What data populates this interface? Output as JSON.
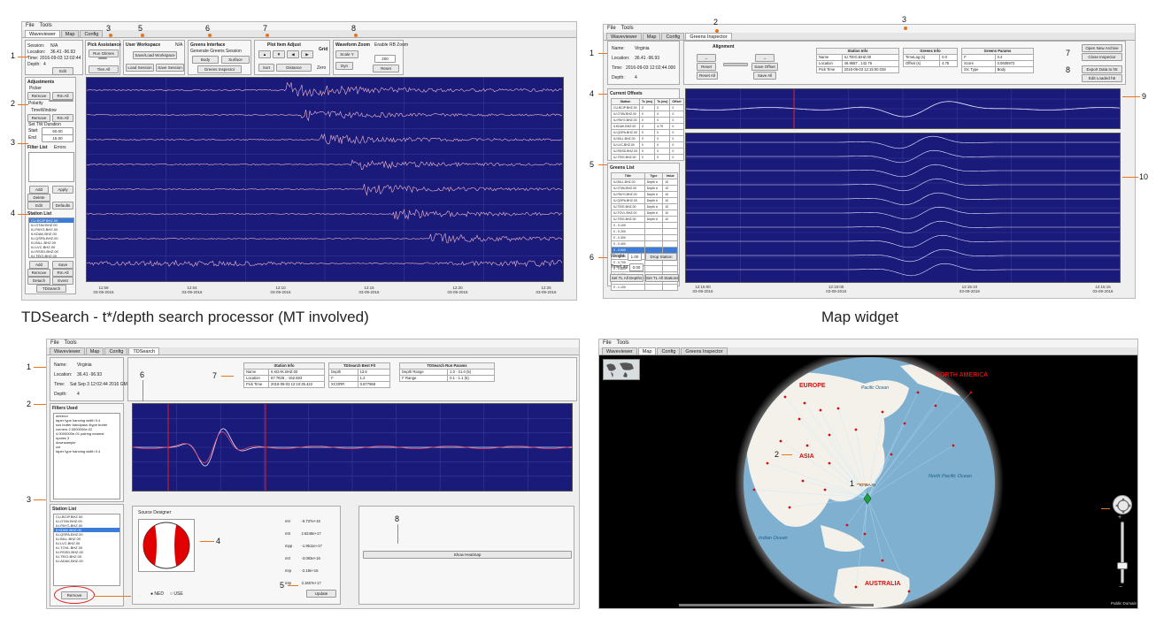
{
  "menu": {
    "file": "File",
    "tools": "Tools"
  },
  "panel1": {
    "tabs": [
      "Waveviewer",
      "Map",
      "Config"
    ],
    "session": {
      "session_lbl": "Session:",
      "session_val": "N/A",
      "location_lbl": "Location:",
      "location_val": "36.41 -96.93",
      "time_lbl": "Time:",
      "time_val": "2016-09-03 12:02:44",
      "depth_lbl": "Depth:",
      "depth_val": "4",
      "edit": "Edit"
    },
    "pick": {
      "title": "Pick Assistance",
      "run": "Run Gtimes",
      "tlen": "Tlen All"
    },
    "workspace": {
      "title": "User Workspace",
      "sub": "N/A",
      "save_load": "Save/Load Workspace",
      "load_session": "Load Session",
      "save_session": "Save Session"
    },
    "greens": {
      "title": "Greens Interface",
      "generate": "Generate Greens Session",
      "body": "Body",
      "surface": "Surface",
      "inspector": "Greens Inspector"
    },
    "plot_adjust": {
      "title": "Plot Item Adjust",
      "sort": "Sort",
      "distance": "Distance"
    },
    "grid": {
      "title": "Grid",
      "zero": "Zero"
    },
    "zoom": {
      "title": "Waveform Zoom",
      "scale": "Scale Y",
      "dyn": "Dyn",
      "enable": "Enable RB Zoom",
      "reset": "Reset",
      "width": "200"
    },
    "adjustments": {
      "title": "Adjustments",
      "picker": "Picker",
      "remove": "Remove",
      "rm_all": "Rm All",
      "polarity": "Polarity",
      "timewindow": "TimeWindow",
      "set_tw": "Set TW Duration",
      "start_lbl": "Start",
      "start_val": "60.00",
      "end_lbl": "End",
      "end_val": "15.00"
    },
    "filter": {
      "title": "Filter List",
      "errors": "Errors",
      "add": "Add",
      "apply": "Apply",
      "delete": "Delete",
      "edit": "Edit",
      "defaults": "Defaults"
    },
    "station": {
      "title": "Station List",
      "items": [
        "CU.BCIP.BHZ.00",
        "IU.OTAV.BHZ.00",
        "IU.PAYG.BHZ.00",
        "II.KDAK.BHZ.00",
        "IU.QSPA.BHZ.00",
        "IU.BILL.BHZ.00",
        "IU.LVC.BHZ.00",
        "IU.RSSD.BHZ.00",
        "IU.TEIG.BHZ.00"
      ],
      "add": "Add",
      "save": "Save",
      "remove": "Remove",
      "rm_all": "Rm All",
      "detach": "Detach",
      "event": "Event",
      "tdsearch": "TDSearch"
    },
    "times": [
      "11:59\n03-09-2016",
      "12:04\n03-09-2016",
      "12:10\n03-09-2016",
      "12:15\n03-09-2016",
      "12:20\n03-09-2016",
      "12:25\n03-09-2016"
    ]
  },
  "panel2": {
    "tabs": [
      "Waveviewer",
      "Map",
      "Config",
      "Greens Inspector"
    ],
    "info": {
      "name_lbl": "Name:",
      "name_val": "Virginia",
      "location_lbl": "Location:",
      "location_val": "36.41 -96.93",
      "time_lbl": "Time:",
      "time_val": "2016-09-03 12:02:44.000",
      "depth_lbl": "Depth:",
      "depth_val": "4"
    },
    "alignment": {
      "title": "Alignment",
      "reset": "Reset",
      "reset_all": "Reset All",
      "save_offset": "Save Offset",
      "save_all": "Save All"
    },
    "station_info": {
      "title": "Station Info",
      "rows": [
        [
          "Name",
          "IU.TEIG.BHZ.00"
        ],
        [
          "Location",
          "46.9587 , 142.76"
        ],
        [
          "Pick Time",
          "2016-09-03 12:15:00.038"
        ]
      ]
    },
    "greens_info": {
      "title": "Greens Info",
      "rows": [
        [
          "TimeLag (s)",
          "0.0"
        ],
        [
          "Offset (s)",
          "4.75"
        ]
      ]
    },
    "greens_params": {
      "title": "Greens Params",
      "rows": [
        [
          "t*",
          "0.4"
        ],
        [
          "Score",
          "0.0606972"
        ],
        [
          "Src Type",
          "Body"
        ]
      ]
    },
    "buttons": {
      "open": "Open New Archive",
      "close": "Close Inspector",
      "export": "Export Data to h5",
      "edit": "Edit Loaded h5"
    },
    "offsets": {
      "title": "Current Offsets",
      "cols": [
        "Station",
        "Tc (ms)",
        "Ts (ms)",
        "Offset"
      ],
      "rows": [
        [
          "CU.BCIP.BHZ.00",
          "0",
          "0",
          "0"
        ],
        [
          "IU.OTAV.BHZ.00",
          "0",
          "0",
          "0"
        ],
        [
          "IU.PAYG.BHZ.00",
          "0",
          "0",
          "0"
        ],
        [
          "II.KDAK.BHZ.00",
          "0",
          "4.75",
          "0"
        ],
        [
          "IU.QSPA.BHZ.00",
          "0",
          "0",
          "0"
        ],
        [
          "IU.BILL.BHZ.00",
          "0",
          "0",
          "0"
        ],
        [
          "IU.LVC.BHZ.00",
          "0",
          "0",
          "0"
        ],
        [
          "IU.RSSD.BHZ.00",
          "0",
          "0",
          "0"
        ],
        [
          "IU.TEIG.BHZ.00",
          "0",
          "0",
          "0"
        ]
      ]
    },
    "greens_list": {
      "title": "Greens List",
      "cols": [
        "Title",
        "Type",
        "Value"
      ],
      "rows": [
        [
          "IU.BILL.BHZ.00",
          "Depth #",
          "10"
        ],
        [
          "IU.OTAV.BHZ.00",
          "Depth #",
          "10"
        ],
        [
          "IU.PAYG.BHZ.00",
          "Depth #",
          "10"
        ],
        [
          "IU.QSPA.BHZ.00",
          "Depth #",
          "10"
        ],
        [
          "IU.TEIG.BHZ.00",
          "Depth #",
          "10"
        ],
        [
          "IU.TOVL.BHZ.00",
          "Depth #",
          "10"
        ],
        [
          "IU.TEIG.BHZ.00",
          "Depth #",
          "10"
        ],
        [
          "0 - 0.100",
          "",
          ""
        ],
        [
          "0 - 0.200",
          "",
          ""
        ],
        [
          "0 - 0.300",
          "",
          ""
        ],
        [
          "0 - 0.400",
          "",
          ""
        ],
        [
          "0 - 0.500",
          "",
          ""
        ],
        [
          "0 - 0.600",
          "",
          ""
        ],
        [
          "0 - 0.700",
          "",
          ""
        ],
        [
          "0 - 0.800",
          "",
          ""
        ],
        [
          "0 - 0.900",
          "",
          ""
        ],
        [
          "0 - 1.000",
          "",
          ""
        ],
        [
          "0 - 1.100",
          "",
          ""
        ]
      ]
    },
    "weight_lbl": "Weight",
    "weight_val": "1.00",
    "drop": "Drop Station",
    "timelag_lbl": "TimeLag",
    "timelag_val": "0.00",
    "set_tl_depths": "Set TL All Depths",
    "set_tl_stations": "Set TL All Stations",
    "times": [
      "12:15:00\n03-09-2016",
      "12:15:05\n03-09-2016",
      "12:15:10\n03-09-2016",
      "12:15:15\n03-09-2016"
    ]
  },
  "panel3": {
    "tabs": [
      "Waveviewer",
      "Map",
      "Config",
      "TDSearch"
    ],
    "info": {
      "name_lbl": "Name:",
      "name_val": "Virginia",
      "location_lbl": "Location:",
      "location_val": "36.41 -96.93",
      "time_lbl": "Time:",
      "time_val": "Sat Sep 3 12:02:44 2016 GMT",
      "depth_lbl": "Depth:",
      "depth_val": "4"
    },
    "station_info": {
      "title": "Station Info",
      "rows": [
        [
          "Name",
          "II.KDAK.BHZ.00"
        ],
        [
          "Location",
          "57.7828 , -152.583"
        ],
        [
          "Pick Time",
          "2016-09-03 12:10:35.422"
        ]
      ]
    },
    "best_fit": {
      "title": "TDSearch Best Fit",
      "rows": [
        [
          "Depth",
          "13.5"
        ],
        [
          "t*",
          "1.2"
        ],
        [
          "XCORR",
          "0.877968"
        ]
      ]
    },
    "run_params": {
      "title": "TDSearch Run Params",
      "rows": [
        [
          "Depth Range",
          "1.0 - 21.0 (5)"
        ],
        [
          "t* Range",
          "0.1 - 1.1 (5)"
        ]
      ]
    },
    "filters": {
      "title": "Filters Used",
      "items": [
        "detrend",
        "taper type hanning width 0.4",
        "sos butter bandpass 4type butter",
        "corners 2.0000000e-02",
        "4.0000000e-01 pairing nearest",
        "npoles 3",
        "downsample",
        "cut",
        "taper type hanning width 0.4"
      ]
    },
    "station": {
      "title": "Station List",
      "items": [
        "CU.BCIP.BHZ.00",
        "IU.OTAV.BHZ.00",
        "IU.PAYG.BHZ.00",
        "II.KDAK.BHZ.00",
        "IU.QSPA.BHZ.00",
        "IU.BILL.BHZ.00",
        "IU.LVC.BHZ.00",
        "IU.TOVL.BHZ.00",
        "IU.RSSD.BHZ.00",
        "IU.TEIG.BHZ.00",
        "IU.ADAK.BHZ.00"
      ],
      "remove": "Remove"
    },
    "source": {
      "title": "Source Designer",
      "ned": "NED",
      "use": "USE",
      "update": "Update",
      "mt": [
        [
          "mrr",
          "-6.737e+16"
        ],
        [
          "mtt",
          "2.6248e+17"
        ],
        [
          "mpp",
          "-1.9511e+17"
        ],
        [
          "mrt",
          "-3.083e+16"
        ],
        [
          "mrp",
          "-2.19e+15"
        ],
        [
          "mtp",
          "3.1657e+17"
        ]
      ]
    },
    "heatmap": "Show Heatmap"
  },
  "panel4": {
    "tabs": [
      "Waveviewer",
      "Map",
      "Config",
      "Greens Inspector"
    ],
    "labels": {
      "europe": "EUROPE",
      "asia": "ASIA",
      "australia": "AUSTRALIA",
      "north_america": "NORTH AMERICA",
      "pacific": "North Pacific Ocean",
      "pacific2": "Pacific Ocean",
      "indian": "Indian Ocean",
      "epicenter": "IU.MAJO"
    },
    "credit": "Public Domain"
  },
  "captions": {
    "left": "TDSearch - t*/depth search processor (MT involved)",
    "right": "Map widget"
  },
  "callouts": {
    "p1": [
      "1",
      "2",
      "3",
      "4",
      "5",
      "6",
      "7",
      "8"
    ],
    "p2": [
      "1",
      "2",
      "3",
      "4",
      "5",
      "6",
      "7",
      "8",
      "9",
      "10"
    ],
    "p3": [
      "1",
      "2",
      "3",
      "4",
      "5",
      "6",
      "7",
      "8"
    ],
    "p4": [
      "1",
      "2",
      "3"
    ]
  },
  "colors": {
    "wave_bg": "#1a1a7a",
    "trace": "#f2b8c8",
    "accent": "#e8741c",
    "ocean": "#7fb0cf",
    "land": "#f3f1ea",
    "red_fault": "#e00000"
  }
}
